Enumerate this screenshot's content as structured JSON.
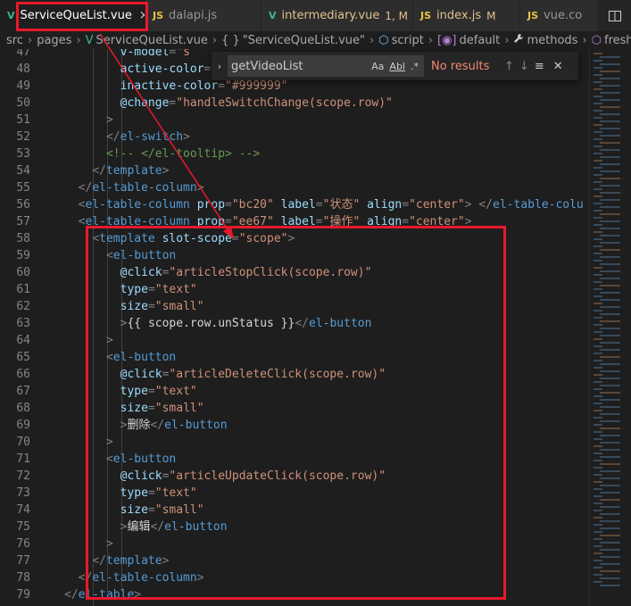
{
  "tabs": [
    {
      "label": "ServiceQueList.vue",
      "icon": "V",
      "close": "×",
      "modified": ""
    },
    {
      "label": "dalapi.js",
      "icon": "JS",
      "close": "",
      "modified": ""
    },
    {
      "label": "intermediary.vue",
      "icon": "V",
      "close": "",
      "modified": "1, M"
    },
    {
      "label": "index.js",
      "icon": "JS",
      "close": "",
      "modified": "M"
    },
    {
      "label": "vue.co",
      "icon": "JS",
      "close": "",
      "modified": ""
    }
  ],
  "tab_overflow_icon": "split-editor-icon",
  "breadcrumb": {
    "items": [
      "src",
      "pages",
      "ServiceQueList.vue",
      "\"ServiceQueList.vue\"",
      "script",
      "default",
      "methods",
      "freshData"
    ],
    "icons": [
      "",
      "",
      "V",
      "{ }",
      "⬡",
      "[◉]",
      "🔧",
      "⬡"
    ]
  },
  "find": {
    "value": "getVideoList",
    "opt_case": "Aa",
    "opt_word": "Abl",
    "opt_regex": ".*",
    "result": "No results",
    "prev": "↑",
    "next": "↓",
    "selection": "≡",
    "close": "✕"
  },
  "lines": [
    {
      "n": "47",
      "text": "        v-model=\"s"
    },
    {
      "n": "48",
      "text": "        active-color=\"#d10024\""
    },
    {
      "n": "49",
      "text": "        inactive-color=\"#999999\""
    },
    {
      "n": "50",
      "text": "        @change=\"handleSwitchChange(scope.row)\""
    },
    {
      "n": "51",
      "text": "      >"
    },
    {
      "n": "52",
      "text": "      </el-switch>"
    },
    {
      "n": "53",
      "text": "      <!-- </el-tooltip> -->"
    },
    {
      "n": "54",
      "text": "    </template>"
    },
    {
      "n": "55",
      "text": "  </el-table-column>"
    },
    {
      "n": "56",
      "text": "  <el-table-column prop=\"bc20\" label=\"状态\" align=\"center\"> </el-table-colu"
    },
    {
      "n": "57",
      "text": "  <el-table-column prop=\"ee67\" label=\"操作\" align=\"center\">"
    },
    {
      "n": "58",
      "text": "    <template slot-scope=\"scope\">"
    },
    {
      "n": "59",
      "text": "      <el-button"
    },
    {
      "n": "60",
      "text": "        @click=\"articleStopClick(scope.row)\""
    },
    {
      "n": "61",
      "text": "        type=\"text\""
    },
    {
      "n": "62",
      "text": "        size=\"small\""
    },
    {
      "n": "63",
      "text": "        >{{ scope.row.unStatus }}</el-button"
    },
    {
      "n": "64",
      "text": "      >"
    },
    {
      "n": "65",
      "text": "      <el-button"
    },
    {
      "n": "66",
      "text": "        @click=\"articleDeleteClick(scope.row)\""
    },
    {
      "n": "67",
      "text": "        type=\"text\""
    },
    {
      "n": "68",
      "text": "        size=\"small\""
    },
    {
      "n": "69",
      "text": "        >删除</el-button"
    },
    {
      "n": "70",
      "text": "      >"
    },
    {
      "n": "71",
      "text": "      <el-button"
    },
    {
      "n": "72",
      "text": "        @click=\"articleUpdateClick(scope.row)\""
    },
    {
      "n": "73",
      "text": "        type=\"text\""
    },
    {
      "n": "74",
      "text": "        size=\"small\""
    },
    {
      "n": "75",
      "text": "        >编辑</el-button"
    },
    {
      "n": "76",
      "text": "      >"
    },
    {
      "n": "77",
      "text": "    </template>"
    },
    {
      "n": "78",
      "text": "  </el-table-column>"
    },
    {
      "n": "79",
      "text": "</el-table>"
    }
  ],
  "colors": {
    "annotation": "#e8192c",
    "tag": "#569cd6",
    "attr": "#9cdcfe",
    "string": "#ce9178",
    "comment": "#6a9955"
  }
}
